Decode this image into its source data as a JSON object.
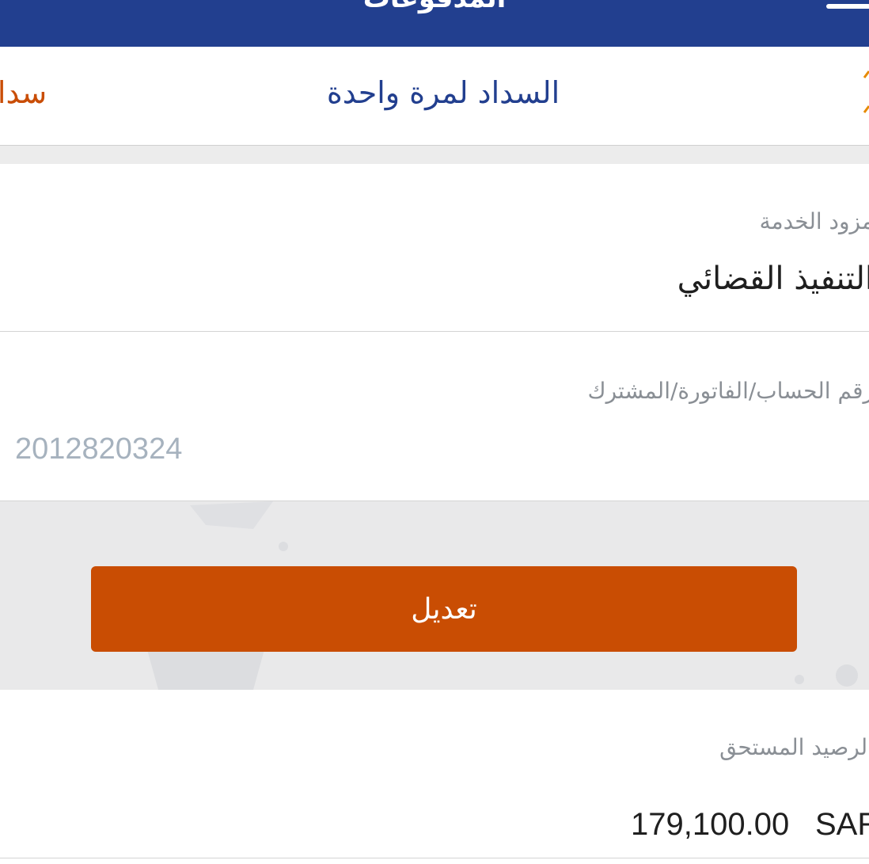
{
  "header": {
    "title": "المدفوعات",
    "bar_color": "#223f8f"
  },
  "tabs": {
    "active_label": "السداد لمرة واحدة",
    "other_label": "سداد",
    "active_color": "#223f8f",
    "other_color": "#c94d06"
  },
  "form": {
    "provider": {
      "label": "مزود الخدمة",
      "value": "التنفيذ القضائي"
    },
    "account": {
      "label": "رقم الحساب/الفاتورة/المشترك",
      "value": "2012820324"
    },
    "edit_label": "تعديل",
    "edit_color": "#c94d03",
    "balance": {
      "label": "الرصيد المستحق",
      "amount": "179,100.00",
      "currency": "SAR"
    }
  },
  "icons": {
    "menu": "menu-icon",
    "edge": "tab-scroll-icon"
  }
}
